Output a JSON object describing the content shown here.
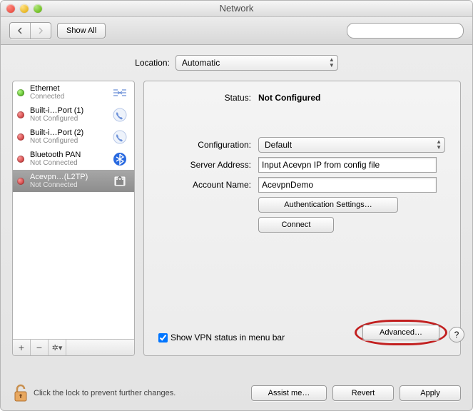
{
  "window": {
    "title": "Network"
  },
  "toolbar": {
    "show_all": "Show All"
  },
  "location": {
    "label": "Location:",
    "value": "Automatic"
  },
  "services": [
    {
      "name": "Ethernet",
      "status": "Connected",
      "dot": "green",
      "icon": "ethernet"
    },
    {
      "name": "Built-i…Port (1)",
      "status": "Not Configured",
      "dot": "red",
      "icon": "phone"
    },
    {
      "name": "Built-i…Port (2)",
      "status": "Not Configured",
      "dot": "red",
      "icon": "phone"
    },
    {
      "name": "Bluetooth PAN",
      "status": "Not Connected",
      "dot": "red",
      "icon": "bluetooth"
    },
    {
      "name": "Acevpn…(L2TP)",
      "status": "Not Connected",
      "dot": "red",
      "icon": "lock",
      "selected": true
    }
  ],
  "detail": {
    "status_label": "Status:",
    "status_value": "Not Configured",
    "config_label": "Configuration:",
    "config_value": "Default",
    "server_label": "Server Address:",
    "server_value": "Input Acevpn IP from config file",
    "account_label": "Account Name:",
    "account_value": "AcevpnDemo",
    "auth_btn": "Authentication Settings…",
    "connect_btn": "Connect",
    "show_status_cb": "Show VPN status in menu bar",
    "advanced_btn": "Advanced…",
    "help": "?"
  },
  "footer": {
    "lock_text": "Click the lock to prevent further changes.",
    "assist": "Assist me…",
    "revert": "Revert",
    "apply": "Apply"
  },
  "sidefoot": {
    "add": "+",
    "remove": "−",
    "gear": "✲▾"
  }
}
